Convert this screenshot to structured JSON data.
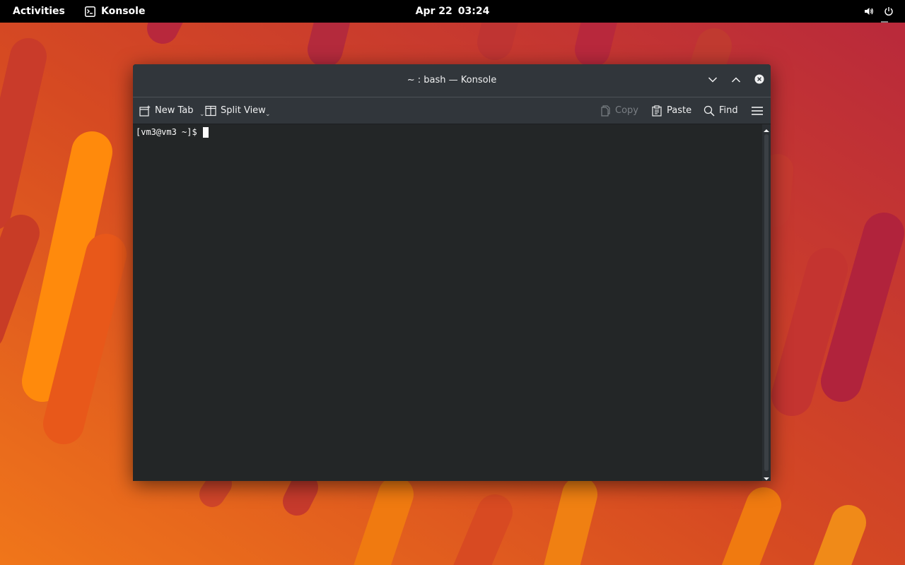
{
  "topbar": {
    "activities": "Activities",
    "app_name": "Konsole",
    "date": "Apr 22",
    "time": "03:24"
  },
  "window": {
    "title": "~ : bash — Konsole"
  },
  "toolbar": {
    "new_tab": "New Tab",
    "split_view": "Split View",
    "copy": "Copy",
    "paste": "Paste",
    "find": "Find"
  },
  "terminal": {
    "prompt": "[vm3@vm3 ~]$"
  },
  "icons": {
    "app": "terminal-icon",
    "volume": "speaker-icon",
    "power": "power-icon",
    "minimize": "chevron-down-icon",
    "maximize": "chevron-up-icon",
    "close": "close-icon",
    "new_tab": "new-tab-icon",
    "split_view": "split-view-icon",
    "copy": "copy-icon",
    "paste": "paste-icon",
    "find": "search-icon",
    "menu": "hamburger-icon"
  },
  "colors": {
    "topbar_bg": "#000000",
    "titlebar_bg": "#31363b",
    "terminal_bg": "#232627",
    "terminal_fg": "#fcfcfc",
    "wallpaper_orange": "#f07a10",
    "wallpaper_red": "#b92a3a"
  }
}
